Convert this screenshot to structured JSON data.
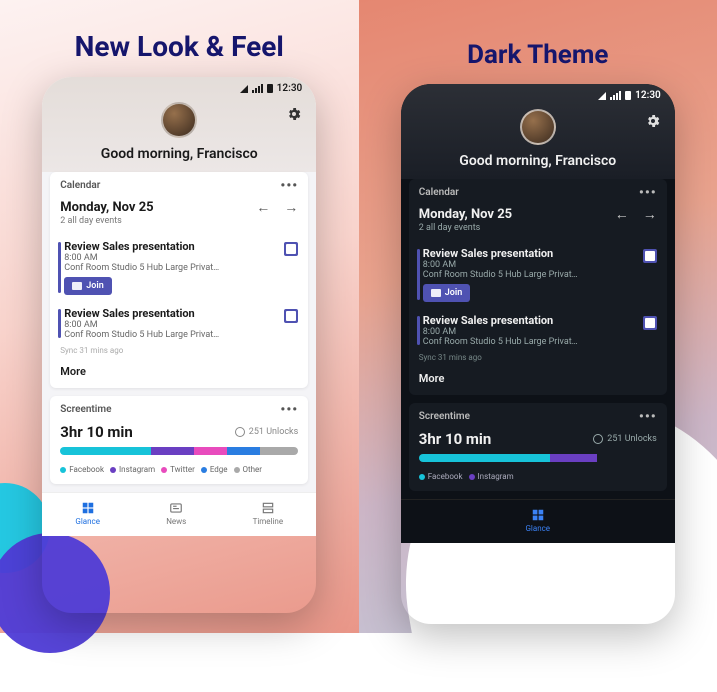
{
  "captions": {
    "left": "New Look & Feel",
    "right": "Dark Theme"
  },
  "status": {
    "time": "12:30"
  },
  "header": {
    "greeting": "Good morning, Francisco"
  },
  "calendar": {
    "label": "Calendar",
    "date": "Monday, Nov 25",
    "alldays": "2 all day events",
    "events": [
      {
        "title": "Review Sales presentation",
        "time": "8:00 AM",
        "loc": "Conf Room Studio 5 Hub Large Privat…",
        "join": "Join"
      },
      {
        "title": "Review Sales presentation",
        "time": "8:00 AM",
        "loc": "Conf Room Studio 5 Hub Large Privat…"
      }
    ],
    "sync": "Sync 31 mins ago",
    "more": "More"
  },
  "screentime": {
    "label": "Screentime",
    "total": "3hr 10 min",
    "unlocks": "251 Unlocks",
    "segments": [
      {
        "name": "Facebook",
        "color": "#17c3d9",
        "pct": 38
      },
      {
        "name": "Instagram",
        "color": "#6a3fc2",
        "pct": 18
      },
      {
        "name": "Twitter",
        "color": "#e84bbd",
        "pct": 14
      },
      {
        "name": "Edge",
        "color": "#2a7de1",
        "pct": 14
      },
      {
        "name": "Other",
        "color": "#a9a9a9",
        "pct": 16
      }
    ],
    "segments_dark": [
      {
        "name": "Facebook",
        "color": "#17c3d9",
        "pct": 55
      },
      {
        "name": "Instagram",
        "color": "#6a3fc2",
        "pct": 20
      }
    ]
  },
  "tabs": {
    "glance": "Glance",
    "news": "News",
    "timeline": "Timeline"
  }
}
